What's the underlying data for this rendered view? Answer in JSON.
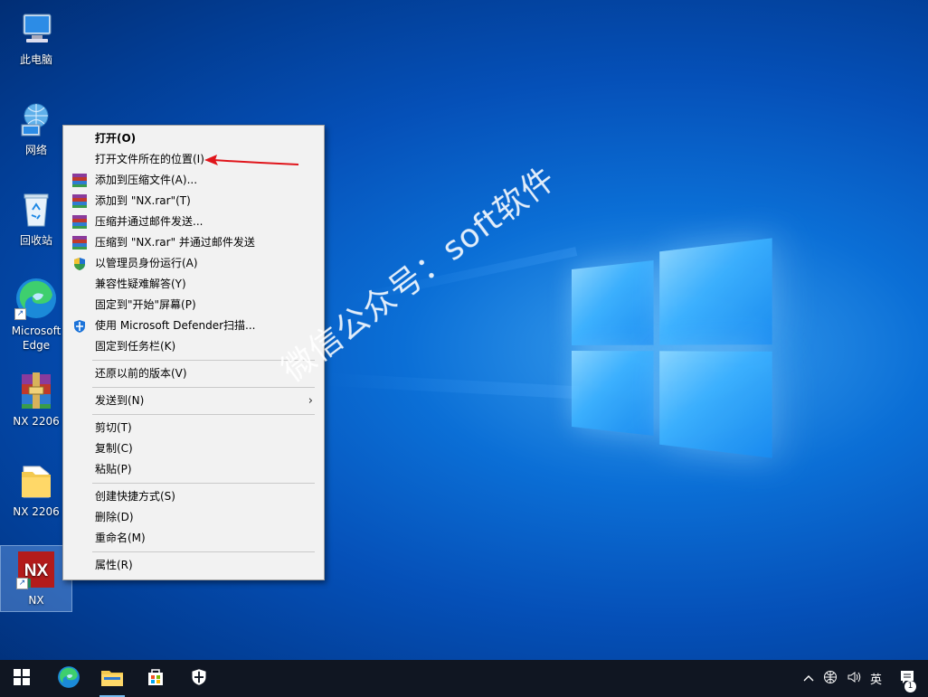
{
  "desktop": {
    "icons": [
      {
        "label": "此电脑",
        "icon": "this-pc-icon"
      },
      {
        "label": "网络",
        "icon": "network-icon"
      },
      {
        "label": "回收站",
        "icon": "recycle-bin-icon"
      },
      {
        "label": "Microsoft Edge",
        "icon": "edge-icon"
      },
      {
        "label": "NX 2206",
        "icon": "winrar-archive-icon"
      },
      {
        "label": "NX 2206",
        "icon": "folder-icon"
      },
      {
        "label": "NX",
        "icon": "nx-app-icon"
      }
    ]
  },
  "context_menu": {
    "items": [
      {
        "label": "打开(O)",
        "bold": true
      },
      {
        "label": "打开文件所在的位置(I)"
      },
      {
        "label": "添加到压缩文件(A)...",
        "icon": "winrar-icon"
      },
      {
        "label": "添加到 \"NX.rar\"(T)",
        "icon": "winrar-icon"
      },
      {
        "label": "压缩并通过邮件发送...",
        "icon": "winrar-icon"
      },
      {
        "label": "压缩到 \"NX.rar\" 并通过邮件发送",
        "icon": "winrar-icon"
      },
      {
        "label": "以管理员身份运行(A)",
        "icon": "uac-shield-icon"
      },
      {
        "label": "兼容性疑难解答(Y)"
      },
      {
        "label": "固定到\"开始\"屏幕(P)"
      },
      {
        "label": "使用 Microsoft Defender扫描...",
        "icon": "defender-icon"
      },
      {
        "label": "固定到任务栏(K)"
      },
      {
        "label": "还原以前的版本(V)"
      },
      {
        "label": "发送到(N)"
      },
      {
        "label": "剪切(T)"
      },
      {
        "label": "复制(C)"
      },
      {
        "label": "粘贴(P)"
      },
      {
        "label": "创建快捷方式(S)"
      },
      {
        "label": "删除(D)"
      },
      {
        "label": "重命名(M)"
      },
      {
        "label": "属性(R)"
      }
    ]
  },
  "watermark": "微信公众号：soft软件",
  "taskbar": {
    "apps": [
      "start-icon",
      "edge-icon",
      "file-explorer-icon",
      "store-icon",
      "security-icon"
    ],
    "tray": {
      "ime": "英",
      "notification_count": "1"
    }
  },
  "colors": {
    "accent": "#0a64d0",
    "taskbar": "#101622",
    "menu_bg": "#f2f2f2",
    "annotation_arrow": "#e0151b"
  }
}
